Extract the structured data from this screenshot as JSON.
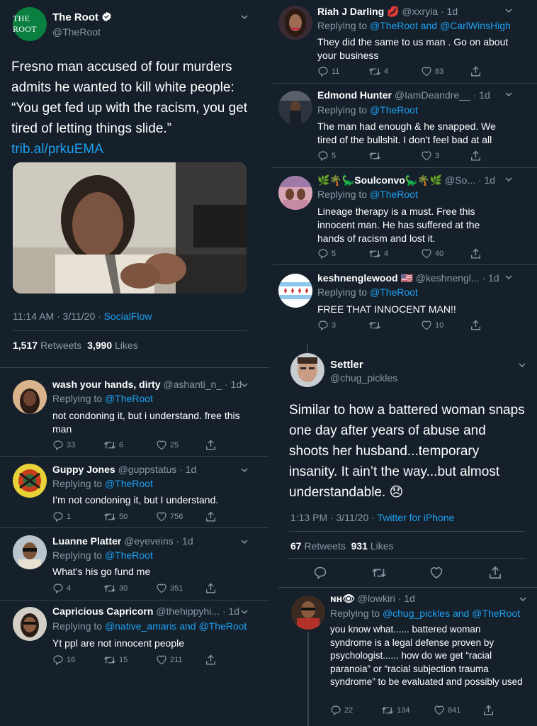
{
  "main_tweet": {
    "logo_text": "THE ROOT",
    "name": "The Root",
    "handle": "@TheRoot",
    "text": "Fresno man accused of four murders admits he wanted to kill white people: “You get fed up with the racism, you get tired of letting things slide.” ",
    "link": "trib.al/prkuEMA",
    "time": "11:14 AM · 3/11/20 · ",
    "source": "SocialFlow",
    "retweets_count": "1,517",
    "retweets_label": "Retweets",
    "likes_count": "3,990",
    "likes_label": "Likes"
  },
  "left_replies": [
    {
      "name": "wash your hands, dirty",
      "handle": "@ashanti_n_ · 1d",
      "replying_prefix": "Replying to ",
      "replying_to": "@TheRoot",
      "text": "not condoning it, but i understand. free this man",
      "replies": "33",
      "retweets": "6",
      "likes": "25"
    },
    {
      "name": "Guppy Jones",
      "handle": "@guppstatus · 1d",
      "replying_prefix": "Replying to ",
      "replying_to": "@TheRoot",
      "text": "I’m not condoning it, but I understand.",
      "replies": "1",
      "retweets": "50",
      "likes": "756"
    },
    {
      "name": "Luanne Platter",
      "handle": "@eyeveins · 1d",
      "replying_prefix": "Replying to ",
      "replying_to": "@TheRoot",
      "text": "What’s his go fund me",
      "replies": "4",
      "retweets": "30",
      "likes": "351"
    },
    {
      "name": "Capricious Capricorn",
      "handle": "@thehippyhi... · 1d",
      "replying_prefix": "Replying to ",
      "replying_to": "@native_amaris and @TheRoot",
      "text": "Yt ppl are not innocent people",
      "replies": "16",
      "retweets": "15",
      "likes": "211"
    }
  ],
  "right_replies": [
    {
      "name": "Riah J Darling 💋",
      "handle": "@xxryia · 1d",
      "replying_prefix": "Replying to ",
      "replying_to": "@TheRoot and @CarlWinsHigh",
      "text": "They did the same to us man . Go on about your business",
      "replies": "11",
      "retweets": "4",
      "likes": "83"
    },
    {
      "name": "Edmond Hunter",
      "handle": "@IamDeandre__ · 1d",
      "replying_prefix": "Replying to ",
      "replying_to": "@TheRoot",
      "text": "The man had enough & he snapped. We tired of the bullshit. I don't feel bad at all",
      "replies": "5",
      "retweets": "",
      "likes": "3"
    },
    {
      "name": "🌿🌴🦕Soulconvo🦕🌴🌿",
      "handle": "@So... · 1d",
      "replying_prefix": "Replying to ",
      "replying_to": "@TheRoot",
      "text": "Lineage therapy is a must. Free this innocent man. He has suffered at the hands of racism and lost it.",
      "replies": "5",
      "retweets": "4",
      "likes": "40"
    },
    {
      "name": "keshnenglewood 🇺🇸",
      "handle": "@keshnengl... · 1d",
      "replying_prefix": "Replying to ",
      "replying_to": "@TheRoot",
      "text": "FREE THAT INNOCENT MAN!!",
      "replies": "3",
      "retweets": "",
      "likes": "10"
    }
  ],
  "settler_tweet": {
    "name": "Settler",
    "handle": "@chug_pickles",
    "text": "Similar to how a battered woman snaps one day after years of abuse and shoots her husband...temporary insanity. It ain’t the way...but almost understandable. 😞",
    "time": "1:13 PM · 3/11/20 · ",
    "source": "Twitter for iPhone",
    "retweets_count": "67",
    "retweets_label": "Retweets",
    "likes_count": "931",
    "likes_label": "Likes"
  },
  "lowkiri_reply": {
    "name": "ɴʜ👁",
    "handle": "@lowkiri · 1d",
    "replying_prefix": "Replying to ",
    "replying_to": "@chug_pickles and @TheRoot",
    "text": "you know what...... battered woman syndrome is a legal defense proven by psychologist...... how do we get “racial paranoia” or “racial subjection trauma syndrome” to be evaluated and possibly used",
    "replies": "22",
    "retweets": "134",
    "likes": "841"
  },
  "colors": {
    "background": "#15202b",
    "accent": "#1da1f2",
    "muted": "#8899a6",
    "divider": "#38444d"
  }
}
